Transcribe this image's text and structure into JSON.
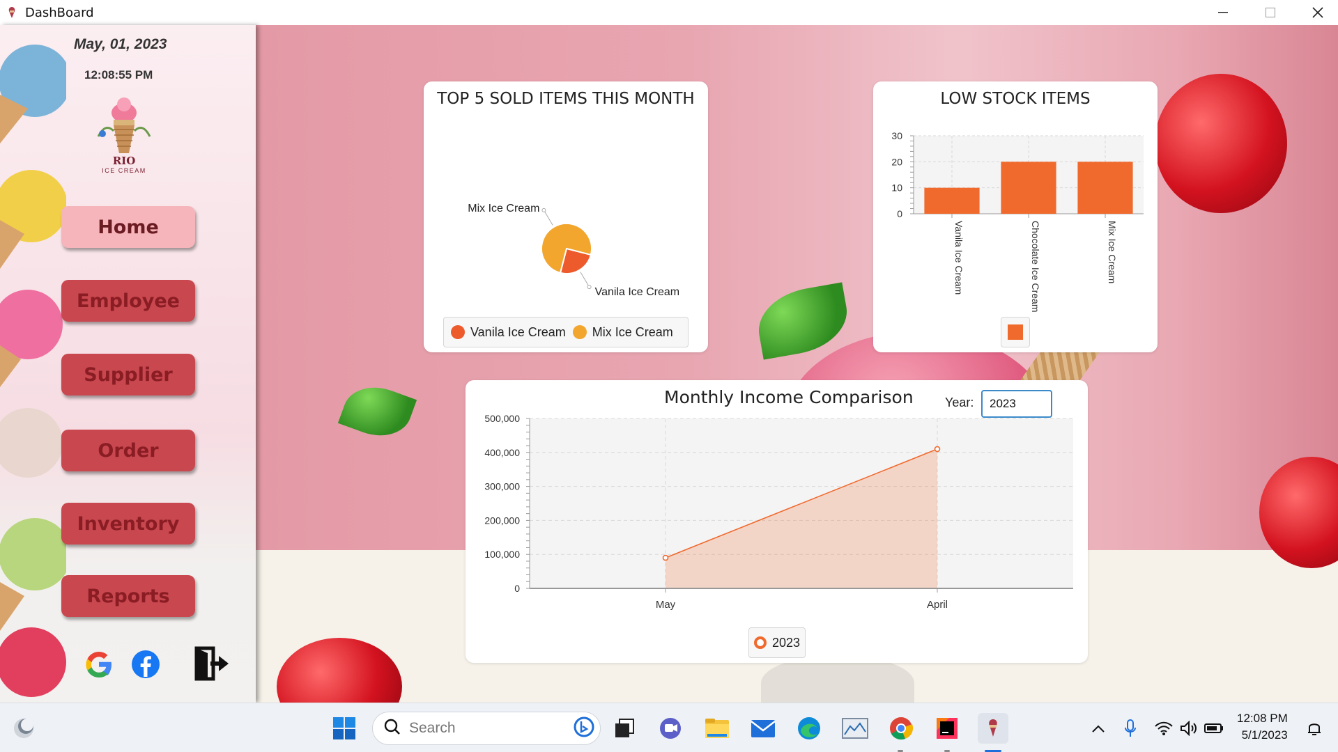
{
  "window": {
    "title": "DashBoard",
    "icon": "ice-cream-icon",
    "controls": [
      "minimize-icon",
      "maximize-icon",
      "close-icon"
    ]
  },
  "sidebar": {
    "date": "May,  01, 2023",
    "time": "12:08:55 PM",
    "logo": {
      "brand": "RIO",
      "subtitle": "ICE CREAM"
    },
    "nav": [
      {
        "label": "Home",
        "active": true
      },
      {
        "label": "Employee",
        "active": false
      },
      {
        "label": "Supplier",
        "active": false
      },
      {
        "label": "Order",
        "active": false
      },
      {
        "label": "Inventory",
        "active": false
      },
      {
        "label": "Reports",
        "active": false
      }
    ],
    "social_icons": [
      "google-icon",
      "facebook-icon",
      "logout-icon"
    ]
  },
  "top_sold": {
    "title": "TOP 5 SOLD ITEMS THIS MONTH",
    "legend": [
      "Vanila Ice Cream",
      "Mix Ice Cream"
    ]
  },
  "low_stock": {
    "title": "LOW STOCK ITEMS"
  },
  "income": {
    "title": "Monthly Income Comparison",
    "year_label": "Year:",
    "year_value": "2023",
    "legend": "2023"
  },
  "colors": {
    "accent_orange": "#f06a2e",
    "pie_light": "#f2a62e",
    "nav_button": "#c9474e",
    "nav_active": "#f6b4bb"
  },
  "chart_data": [
    {
      "type": "pie",
      "title": "TOP 5 SOLD ITEMS THIS MONTH",
      "labels": [
        "Vanila Ice Cream",
        "Mix Ice Cream"
      ],
      "values": [
        1,
        3
      ],
      "colors": [
        "#ed5a2c",
        "#f2a62e"
      ],
      "legend": "bottom"
    },
    {
      "type": "bar",
      "title": "LOW STOCK ITEMS",
      "categories": [
        "Vanila Ice Cream",
        "Chocolate Ice Cream",
        "Mix Ice Cream"
      ],
      "values": [
        10,
        20,
        20
      ],
      "ylim": [
        0,
        30
      ],
      "yticks": [
        "0",
        "10",
        "20",
        "30"
      ],
      "grid": true,
      "color": "#f06a2e"
    },
    {
      "type": "area",
      "title": "Monthly Income Comparison",
      "categories": [
        "May",
        "April"
      ],
      "series": [
        {
          "name": "2023",
          "values": [
            90000,
            410000
          ]
        }
      ],
      "ylim": [
        0,
        500000
      ],
      "yticks": [
        "0",
        "100,000",
        "200,000",
        "300,000",
        "400,000",
        "500,000"
      ],
      "grid": true,
      "legend": "bottom",
      "color": "#f06a2e"
    }
  ],
  "taskbar": {
    "search_placeholder": "Search",
    "clock_time": "12:08 PM",
    "clock_date": "5/1/2023",
    "apps": [
      "widgets-icon",
      "windows-start-icon",
      "task-view-icon",
      "teams-icon",
      "file-explorer-icon",
      "mail-icon",
      "edge-icon",
      "chart-app-icon",
      "chrome-icon",
      "intellij-icon",
      "ice-cream-app-icon"
    ],
    "tray": [
      "chevron-up-icon",
      "microphone-icon",
      "wifi-icon",
      "speaker-icon",
      "battery-icon",
      "notification-icon"
    ]
  }
}
